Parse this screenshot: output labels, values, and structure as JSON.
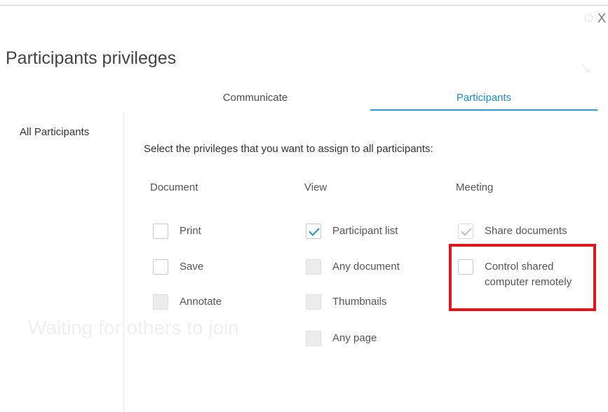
{
  "dialog": {
    "title": "Participants privileges",
    "close_label": "X"
  },
  "tabs": [
    {
      "label": "Communicate",
      "active": false
    },
    {
      "label": "Participants",
      "active": true
    }
  ],
  "sidebar": {
    "items": [
      {
        "label": "All Participants",
        "selected": true
      }
    ]
  },
  "main": {
    "instruction": "Select the privileges that you want to assign to all participants:",
    "background_text": "Waiting for others to join",
    "columns": [
      {
        "heading": "Document",
        "options": [
          {
            "label": "Print",
            "checked": false,
            "enabled": true
          },
          {
            "label": "Save",
            "checked": false,
            "enabled": true
          },
          {
            "label": "Annotate",
            "checked": false,
            "enabled": false
          }
        ]
      },
      {
        "heading": "View",
        "options": [
          {
            "label": "Participant list",
            "checked": true,
            "enabled": true
          },
          {
            "label": "Any document",
            "checked": false,
            "enabled": false
          },
          {
            "label": "Thumbnails",
            "checked": false,
            "enabled": false
          },
          {
            "label": "Any page",
            "checked": false,
            "enabled": false
          }
        ]
      },
      {
        "heading": "Meeting",
        "options": [
          {
            "label": "Share documents",
            "checked": true,
            "enabled": false
          },
          {
            "label": "Control shared computer remotely",
            "checked": false,
            "enabled": true,
            "highlighted": true
          }
        ]
      }
    ]
  },
  "colors": {
    "accent": "#2b9ad6",
    "highlight": "#e0161f"
  },
  "icons": {
    "close": "close-icon",
    "checkmark": "checkmark-icon"
  }
}
